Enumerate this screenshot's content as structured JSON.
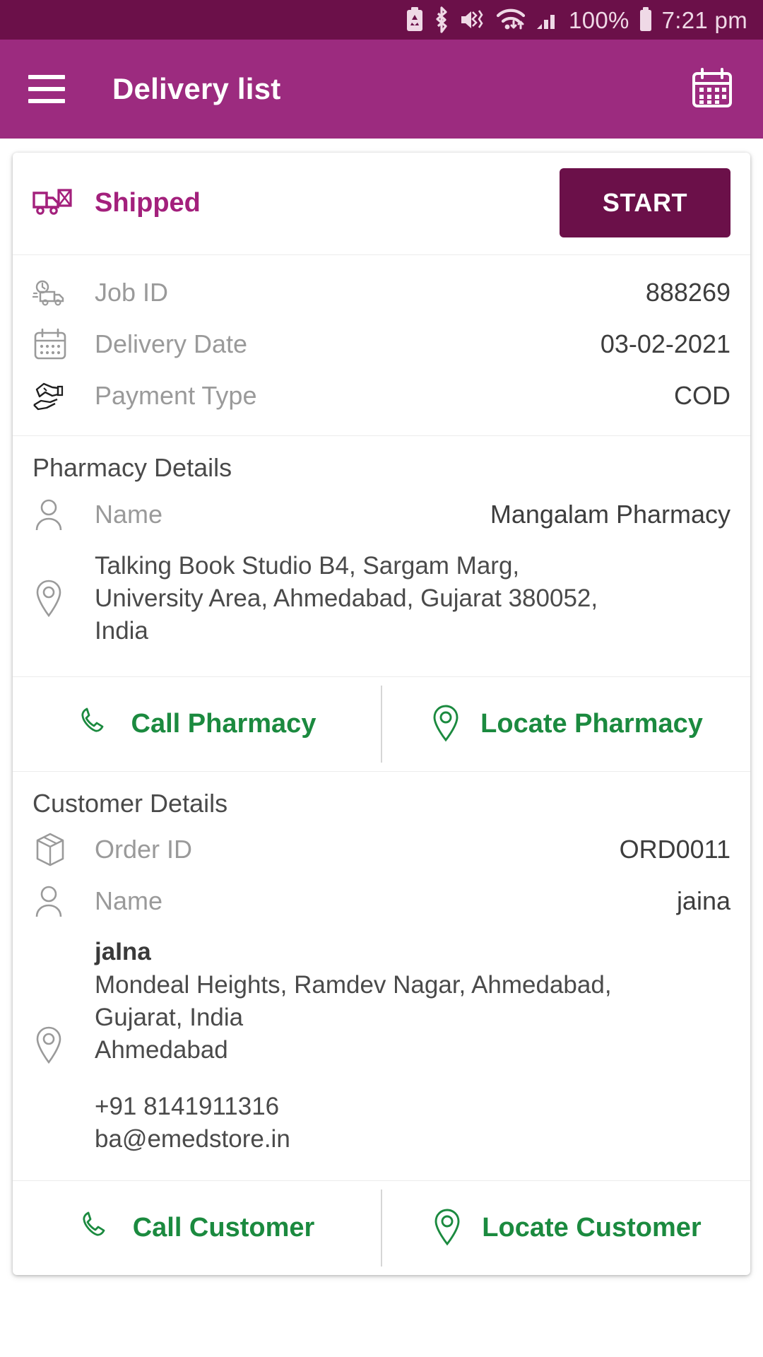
{
  "status_bar": {
    "battery_percent": "100%",
    "time": "7:21 pm",
    "icons": [
      "battery-saver-icon",
      "bluetooth-icon",
      "vibrate-mute-icon",
      "wifi-icon",
      "signal-bars-icon",
      "battery-icon"
    ]
  },
  "app_bar": {
    "title": "Delivery list",
    "menu_icon": "hamburger-menu-icon",
    "calendar_icon": "calendar-icon"
  },
  "card": {
    "status": {
      "icon": "shipping-truck-icon",
      "label": "Shipped",
      "start_label": "START"
    },
    "details": [
      {
        "icon": "delivery-truck-clock-icon",
        "label": "Job ID",
        "value": "888269"
      },
      {
        "icon": "calendar-icon",
        "label": "Delivery Date",
        "value": "03-02-2021"
      },
      {
        "icon": "cash-in-hand-icon",
        "label": "Payment Type",
        "value": "COD"
      }
    ],
    "pharmacy": {
      "heading": "Pharmacy Details",
      "name_label": "Name",
      "name_value": "Mangalam Pharmacy",
      "address": "Talking Book Studio B4, Sargam Marg, University Area, Ahmedabad, Gujarat 380052, India",
      "call_label": "Call Pharmacy",
      "locate_label": "Locate Pharmacy"
    },
    "customer": {
      "heading": "Customer Details",
      "order_id_label": "Order ID",
      "order_id_value": "ORD0011",
      "name_label": "Name",
      "name_value": "jaina",
      "address_name": "jaIna",
      "address_line1": "Mondeal Heights, Ramdev Nagar, Ahmedabad,",
      "address_line2": "Gujarat, India",
      "address_city": "Ahmedabad",
      "phone": "+91 8141911316",
      "email": "ba@emedstore.in",
      "call_label": "Call Customer",
      "locate_label": "Locate Customer"
    }
  },
  "colors": {
    "status_bar": "#6B1049",
    "app_bar": "#9C2B7F",
    "accent_magenta": "#A3207C",
    "start_button": "#6B1049",
    "action_green": "#1B8A3F"
  }
}
